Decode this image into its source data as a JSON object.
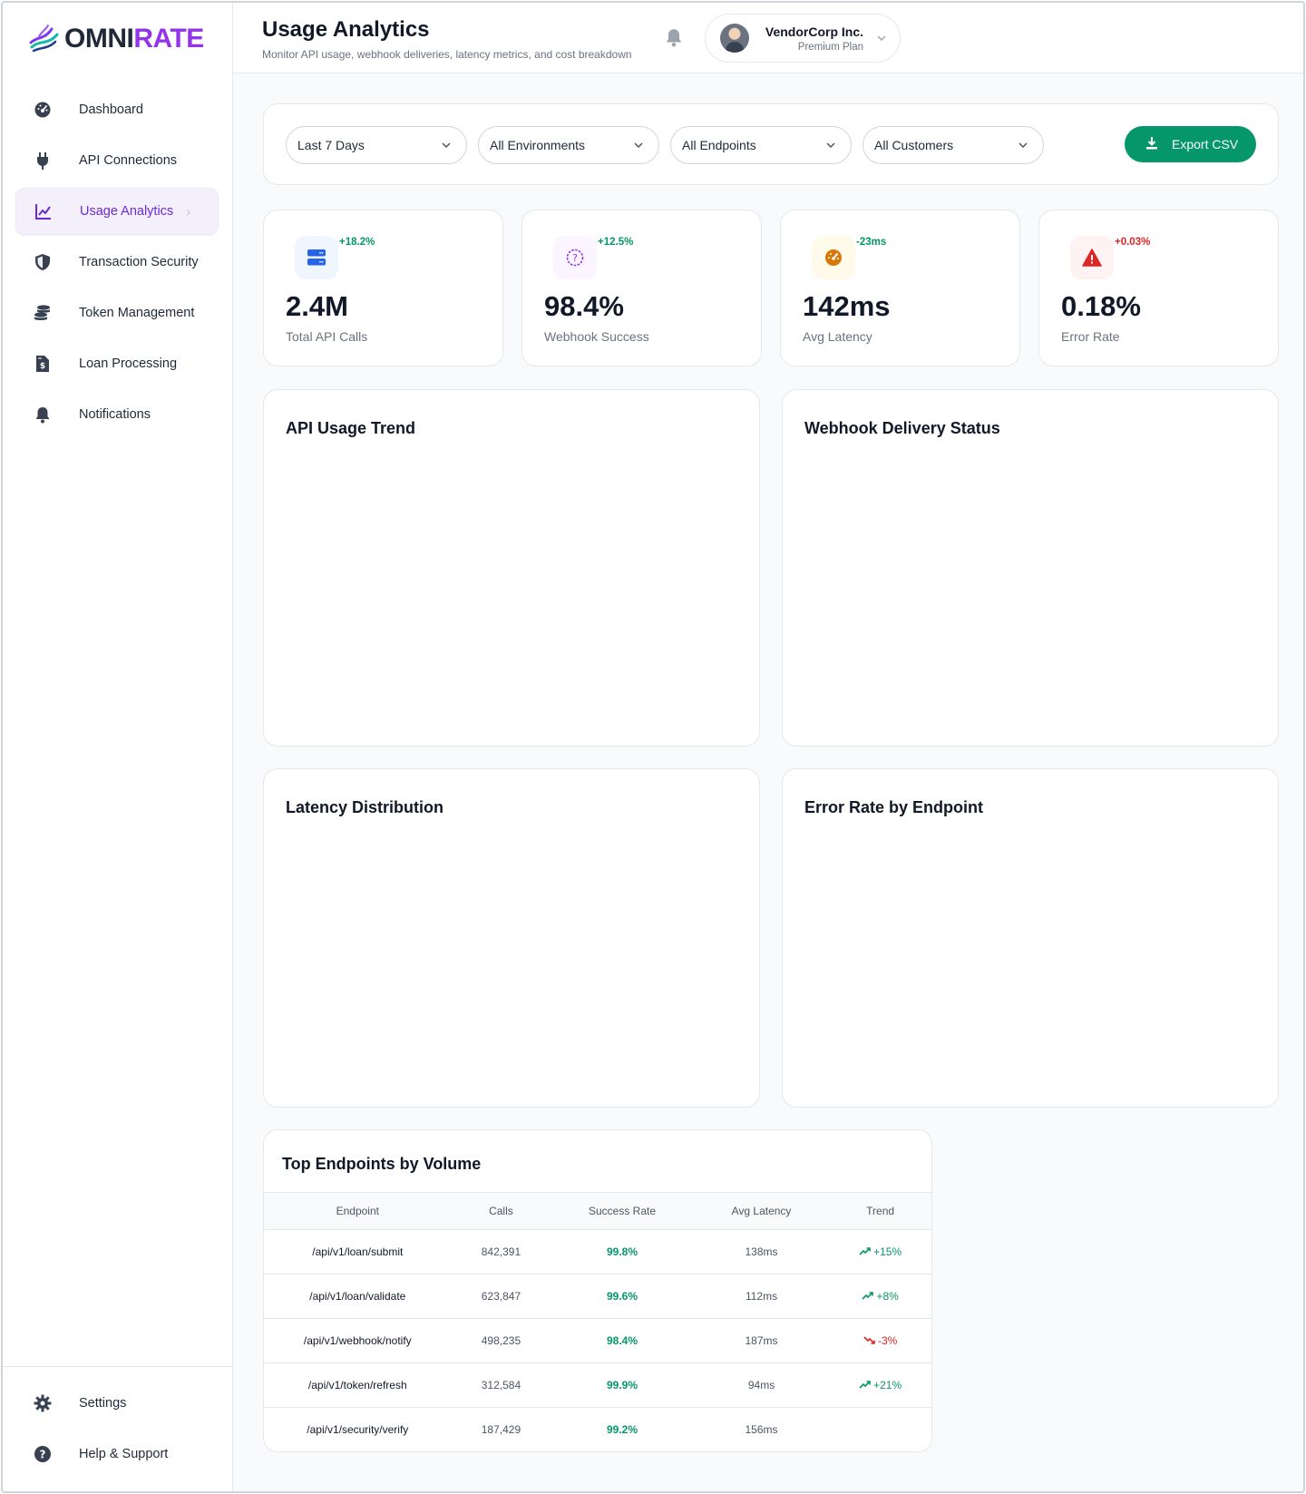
{
  "brand": {
    "part1": "OMNI",
    "part2": "RATE"
  },
  "sidebar": {
    "items": [
      {
        "label": "Dashboard",
        "icon": "dashboard-gauge-icon"
      },
      {
        "label": "API Connections",
        "icon": "plug-icon"
      },
      {
        "label": "Usage Analytics",
        "icon": "chart-line-icon",
        "active": true
      },
      {
        "label": "Transaction Security",
        "icon": "shield-icon"
      },
      {
        "label": "Token Management",
        "icon": "coins-icon"
      },
      {
        "label": "Loan Processing",
        "icon": "file-invoice-dollar-icon"
      },
      {
        "label": "Notifications",
        "icon": "bell-icon"
      }
    ],
    "bottom": [
      {
        "label": "Settings",
        "icon": "gear-icon"
      },
      {
        "label": "Help & Support",
        "icon": "question-circle-icon"
      }
    ]
  },
  "header": {
    "title": "Usage Analytics",
    "subtitle": "Monitor API usage, webhook deliveries, latency metrics, and cost breakdown",
    "account": {
      "name": "VendorCorp Inc.",
      "plan": "Premium Plan"
    }
  },
  "filters": {
    "period": "Last 7 Days",
    "environment": "All Environments",
    "endpoint": "All Endpoints",
    "customer": "All Customers",
    "export_label": "Export CSV"
  },
  "stats": [
    {
      "value": "2.4M",
      "label": "Total API Calls",
      "delta": "+18.2%",
      "delta_color": "#059669",
      "icon": "server-icon",
      "icon_bg": "#eff6ff",
      "icon_color": "#2563eb"
    },
    {
      "value": "98.4%",
      "label": "Webhook Success",
      "delta": "+12.5%",
      "delta_color": "#059669",
      "icon": "question-circle-icon",
      "icon_bg": "#faf5ff",
      "icon_color": "#9333ea"
    },
    {
      "value": "142ms",
      "label": "Avg Latency",
      "delta": "-23ms",
      "delta_color": "#059669",
      "icon": "speedometer-icon",
      "icon_bg": "#fffbeb",
      "icon_color": "#d97706"
    },
    {
      "value": "0.18%",
      "label": "Error Rate",
      "delta": "+0.03%",
      "delta_color": "#dc2626",
      "icon": "warning-triangle-icon",
      "icon_bg": "#fef2f2",
      "icon_color": "#dc2626"
    }
  ],
  "panels": {
    "usage_trend": "API Usage Trend",
    "webhook_status": "Webhook Delivery Status",
    "latency_distribution": "Latency Distribution",
    "error_rate": "Error Rate by Endpoint"
  },
  "table": {
    "title": "Top Endpoints by Volume",
    "columns": [
      "Endpoint",
      "Calls",
      "Success Rate",
      "Avg Latency",
      "Trend"
    ],
    "rows": [
      {
        "endpoint": "/api/v1/loan/submit",
        "calls": "842,391",
        "success": "99.8%",
        "latency": "138ms",
        "trend": "+15%",
        "direction": "up"
      },
      {
        "endpoint": "/api/v1/loan/validate",
        "calls": "623,847",
        "success": "99.6%",
        "latency": "112ms",
        "trend": "+8%",
        "direction": "up"
      },
      {
        "endpoint": "/api/v1/webhook/notify",
        "calls": "498,235",
        "success": "98.4%",
        "latency": "187ms",
        "trend": "-3%",
        "direction": "down"
      },
      {
        "endpoint": "/api/v1/token/refresh",
        "calls": "312,584",
        "success": "99.9%",
        "latency": "94ms",
        "trend": "+21%",
        "direction": "up"
      },
      {
        "endpoint": "/api/v1/security/verify",
        "calls": "187,429",
        "success": "99.2%",
        "latency": "156ms",
        "trend": "",
        "direction": ""
      }
    ]
  },
  "colors": {
    "accent": "#7c3aed",
    "primary_button": "#059669",
    "positive": "#059669",
    "negative": "#dc2626"
  }
}
